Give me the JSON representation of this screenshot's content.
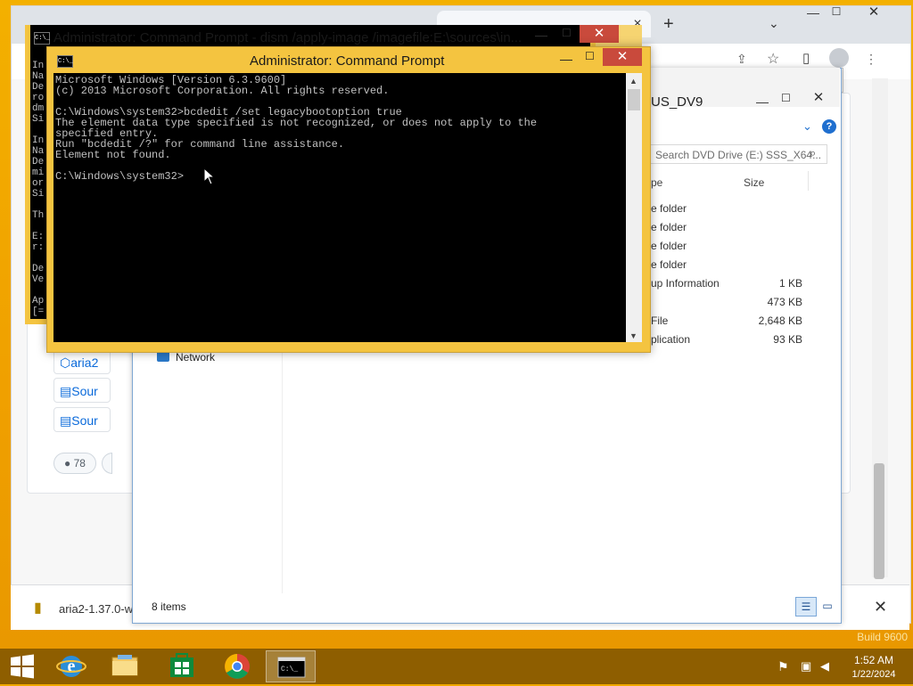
{
  "desktop": {
    "branding": "Build 9600"
  },
  "chrome": {
    "tab_close": "×",
    "new_tab": "+",
    "tabs_dropdown": "⌄",
    "window_min": "—",
    "window_max": "☐",
    "window_close": "✕",
    "page_links": [
      "aria2",
      "Sour",
      "Sour"
    ],
    "reaction_count": "78",
    "download_file": "aria2-1.37.0-w",
    "download_close": "✕"
  },
  "explorer": {
    "title": "US_DV9",
    "search_placeholder": "Search DVD Drive (E:) SSS_X64...",
    "columns": {
      "type": "pe",
      "size": "Size"
    },
    "nav": {
      "network": "Network"
    },
    "rows": [
      {
        "type": "e folder",
        "size": ""
      },
      {
        "type": "e folder",
        "size": ""
      },
      {
        "type": "e folder",
        "size": ""
      },
      {
        "type": "e folder",
        "size": ""
      },
      {
        "type": "up Information",
        "size": "1 KB"
      },
      {
        "type": "",
        "size": "473 KB"
      },
      {
        "type": "File",
        "size": "2,648 KB"
      },
      {
        "type": "plication",
        "size": "93 KB"
      }
    ],
    "status": "8 items",
    "help": "?"
  },
  "cmd_back": {
    "title": "Administrator: Command Prompt - dism  /apply-image /imagefile:E:\\sources\\in...",
    "icon_text": "C:\\_",
    "visible_text": "In\nNa\nDe\nro\ndm\nSi\n\nIn\nNa\nDe\nmi\nor\nSi\n\nTh\n\nE:\nr:\n\nDe\nVe\n\nAp\n[="
  },
  "cmd_front": {
    "title": "Administrator: Command Prompt",
    "icon_text": "C:\\_",
    "output": "Microsoft Windows [Version 6.3.9600]\n(c) 2013 Microsoft Corporation. All rights reserved.\n\nC:\\Windows\\system32>bcdedit /set legacybootoption true\nThe element data type specified is not recognized, or does not apply to the\nspecified entry.\nRun \"bcdedit /?\" for command line assistance.\nElement not found.\n\nC:\\Windows\\system32>"
  },
  "taskbar": {
    "time": "1:52 AM",
    "date": "1/22/2024"
  },
  "colors": {
    "desktop": "#f0a800",
    "cmd_frame": "#f4c440",
    "close_button": "#c94a3c",
    "taskbar": "#7a5000"
  }
}
